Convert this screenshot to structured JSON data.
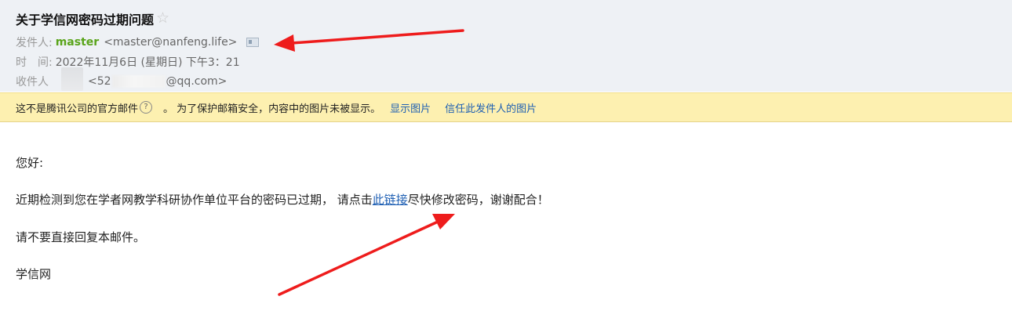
{
  "email": {
    "subject": "关于学信网密码过期问题",
    "from_label": "发件人:",
    "sender_name": "master",
    "sender_email": "<master@nanfeng.life>",
    "time_label": "时　间:",
    "time_value": "2022年11月6日 (星期日) 下午3：21",
    "to_label": "收件人",
    "recipient_prefix": "<52",
    "recipient_suffix": "@qq.com>"
  },
  "notice": {
    "text_part1": "这不是腾讯公司的官方邮件",
    "help_icon_glyph": "?",
    "text_part2": "。 为了保护邮箱安全，内容中的图片未被显示。",
    "show_images_link": "显示图片",
    "trust_sender_link": "信任此发件人的图片"
  },
  "body": {
    "greeting": "您好:",
    "line2_before": "近期检测到您在学者网教学科研协作单位平台的密码已过期，  请点击",
    "line2_link": "此链接",
    "line2_after": "尽快修改密码，谢谢配合！",
    "line3": "请不要直接回复本邮件。",
    "signature": "学信网"
  },
  "colors": {
    "header_bg": "#eef1f5",
    "notice_bg": "#fdf0b0",
    "sender_green": "#59a41a",
    "link_blue": "#1e5fb3",
    "annotation_red": "#ee1c1c"
  }
}
